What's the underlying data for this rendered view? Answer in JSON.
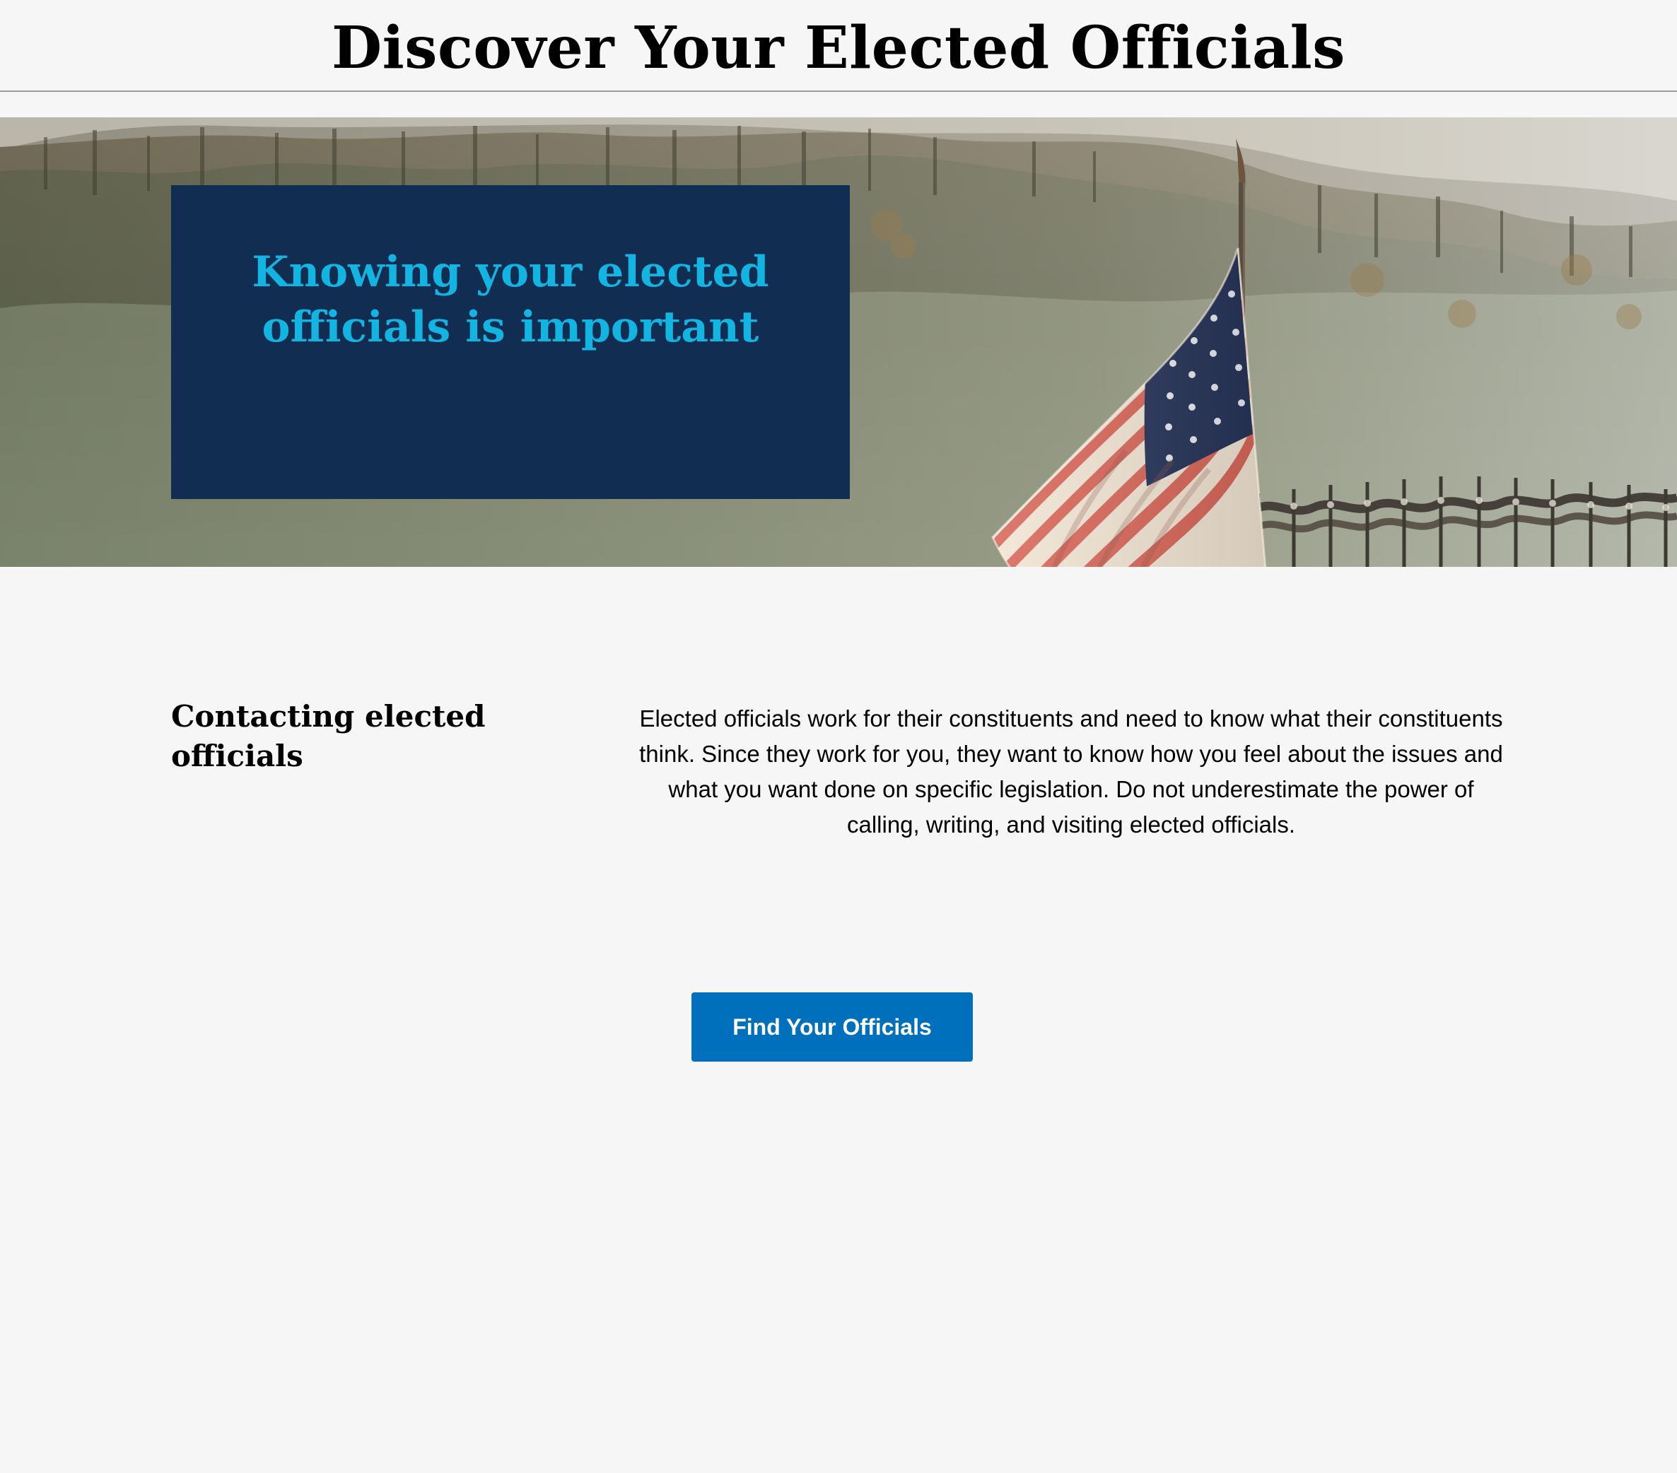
{
  "header": {
    "title": "Discover Your Elected Officials"
  },
  "hero": {
    "heading_line1": "Knowing your elected",
    "heading_line2": "officials is important",
    "image_subject": "american-flag-on-railing-with-hillside-background"
  },
  "main": {
    "section_title": "Contacting elected officials",
    "body": "Elected officials work for their constituents and need to know what their constituents think. Since they work for you, they want to know how you feel about the issues and what you want done on specific legislation. Do not underestimate the power of calling, writing, and visiting elected officials.",
    "cta_label": "Find Your Officials"
  },
  "colors": {
    "page_background": "#f6f6f6",
    "hero_panel": "#122d52",
    "hero_heading": "#12b4e2",
    "cta_background": "#0070bc",
    "cta_text": "#ffffff"
  }
}
